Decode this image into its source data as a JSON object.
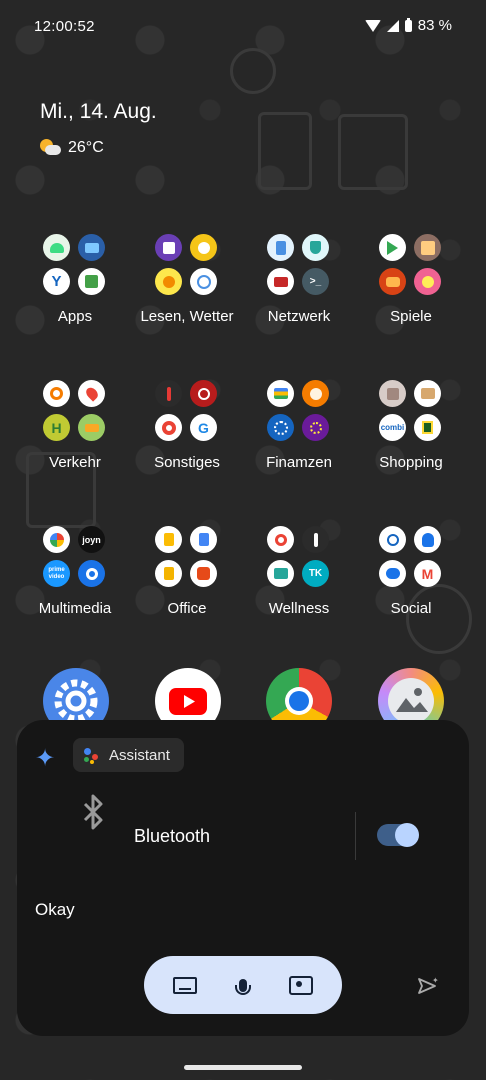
{
  "status_bar": {
    "time": "12:00:52",
    "battery_label": "83 %"
  },
  "home": {
    "date": "Mi., 14. Aug.",
    "temperature": "26°C"
  },
  "folders": [
    {
      "label": "Apps"
    },
    {
      "label": "Lesen, Wetter"
    },
    {
      "label": "Netzwerk"
    },
    {
      "label": "Spiele"
    },
    {
      "label": "Verkehr"
    },
    {
      "label": "Sonstiges"
    },
    {
      "label": "Finamzen"
    },
    {
      "label": "Shopping"
    },
    {
      "label": "Multimedia"
    },
    {
      "label": "Office"
    },
    {
      "label": "Wellness"
    },
    {
      "label": "Social"
    }
  ],
  "mini_icon_text": {
    "joyn": "joyn",
    "prime": "prime video",
    "combi": "combi"
  },
  "assistant": {
    "chip_label": "Assistant",
    "bluetooth_label": "Bluetooth",
    "bluetooth_enabled": true,
    "response": "Okay"
  },
  "colors": {
    "panel": "#161616",
    "pill": "#d8e4fb",
    "accent": "#5b9af7"
  }
}
